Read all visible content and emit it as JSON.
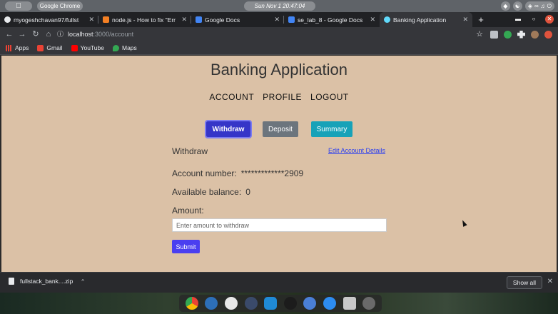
{
  "os": {
    "apple_label": "",
    "app_name": "Google Chrome",
    "clock": "Sun Nov 1  20:47:04"
  },
  "tabs": [
    {
      "label": "myogeshchavan97/fullst",
      "favicon_color": "#e8eaed",
      "active": false
    },
    {
      "label": "node.js - How to fix \"Err",
      "favicon_color": "#f48024",
      "active": false
    },
    {
      "label": "Google Docs",
      "favicon_color": "#4285f4",
      "active": false
    },
    {
      "label": "se_lab_8 - Google Docs",
      "favicon_color": "#4285f4",
      "active": false
    },
    {
      "label": "Banking Application",
      "favicon_color": "#61dafb",
      "active": true
    }
  ],
  "address": {
    "host": "localhost",
    "path": ":3000/account"
  },
  "bookmarks": [
    {
      "label": "Apps",
      "icon_color": "#ea4335"
    },
    {
      "label": "Gmail",
      "icon_color": "#ea4335"
    },
    {
      "label": "YouTube",
      "icon_color": "#ff0000"
    },
    {
      "label": "Maps",
      "icon_color": "#34a853"
    }
  ],
  "page": {
    "title": "Banking Application",
    "nav": [
      "ACCOUNT",
      "PROFILE",
      "LOGOUT"
    ],
    "buttons": {
      "withdraw": "Withdraw",
      "deposit": "Deposit",
      "summary": "Summary"
    },
    "section_title": "Withdraw",
    "edit_link": "Edit Account Details",
    "account_number_label": "Account number:",
    "account_number_value": "*************2909",
    "balance_label": "Available balance:",
    "balance_value": "0",
    "amount_label": "Amount:",
    "amount_placeholder": "Enter amount to withdraw",
    "submit_label": "Submit"
  },
  "download": {
    "filename": "fullstack_bank....zip",
    "show_all": "Show all"
  },
  "colors": {
    "page_bg": "#dbc1a6",
    "withdraw_btn": "#3535c8",
    "deposit_btn": "#6c757d",
    "summary_btn": "#17a2b8",
    "submit_btn": "#4a3ff0"
  }
}
